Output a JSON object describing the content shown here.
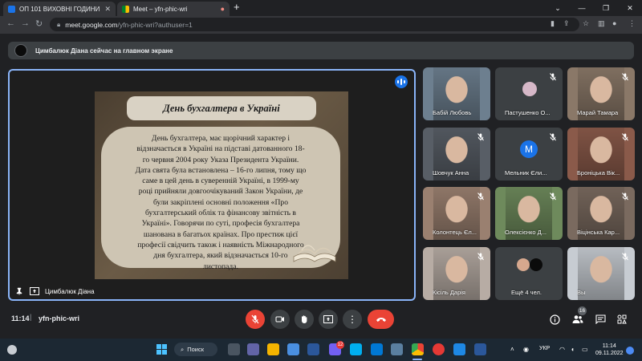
{
  "browser": {
    "tabs": [
      {
        "label": "ОП 101 ВИХОВНІ ГОДИНИ",
        "favicon_color": "#1a73e8"
      },
      {
        "label": "Meet – yfn-phic-wri",
        "favicon_color": "#00832d"
      }
    ],
    "url_host": "meet.google.com",
    "url_path": "/yfn-phic-wri?authuser=1"
  },
  "meet": {
    "presenter_banner": "Цимбалюк Діана сейчас на главном экране",
    "slide": {
      "title": "День бухгалтера в Україні",
      "lines": [
        "День бухгалтера, має щорічний характер і",
        "відзначається в Україні на підставі датованного 18-",
        "го червня 2004 року Указа Президента України.",
        "Дата свята була встановлена – 16-го липня, тому що",
        "саме в цей день в суверенній Україні, в 1999-му",
        "році прийняли довгоочікуваний Закон України, де",
        "були закріплені основні положення «Про",
        "бухгалтерський облік та фінансову звітність в",
        "Україні». Говорячи по суті, професія бухгалтера",
        "шанована в багатьох країнах. Про престиж цієї",
        "професії свідчить також і наявність Міжнародного",
        "дня бухгалтера, який відзначається 10-го",
        "листопада."
      ]
    },
    "presenter_name": "Цимбалюк Діана",
    "participants": [
      {
        "name": "Бабій Любовь",
        "kind": "photo",
        "bg": "#6d7f8f",
        "muted": false
      },
      {
        "name": "Пастушенко О...",
        "kind": "photo-small",
        "bg": "#3c4043",
        "muted": true
      },
      {
        "name": "Марай Тамара",
        "kind": "photo",
        "bg": "#8a7868",
        "muted": true
      },
      {
        "name": "Шовчук Анна",
        "kind": "photo",
        "bg": "#585e66",
        "muted": true
      },
      {
        "name": "Мельник Єли...",
        "kind": "avatar",
        "avatar_letter": "M",
        "bg": "#3c4043",
        "muted": true
      },
      {
        "name": "Броніцька Вік...",
        "kind": "photo",
        "bg": "#8a5a4a",
        "muted": true
      },
      {
        "name": "Колонтець Єл...",
        "kind": "photo",
        "bg": "#9a8070",
        "muted": true
      },
      {
        "name": "Олексієнко Д...",
        "kind": "photo",
        "bg": "#6e8a5c",
        "muted": true
      },
      {
        "name": "Віцінська Кар...",
        "kind": "photo",
        "bg": "#7a6a5f",
        "muted": true
      },
      {
        "name": "Кісіль Дарія",
        "kind": "photo",
        "bg": "#b7aca4",
        "muted": true
      },
      {
        "name": "Ещё 4 чел.",
        "kind": "more",
        "bg": "#3c4043",
        "muted": false
      },
      {
        "name": "Вы",
        "kind": "photo",
        "bg": "#c7ccd2",
        "muted": true
      }
    ],
    "clock": "11:14",
    "separator": "|",
    "meeting_code": "yfn-phic-wri",
    "people_count": "16"
  },
  "taskbar": {
    "search_label": "Поиск",
    "notification_badge": "12",
    "lang": "УКР",
    "time": "11:14",
    "date": "09.11.2022"
  }
}
